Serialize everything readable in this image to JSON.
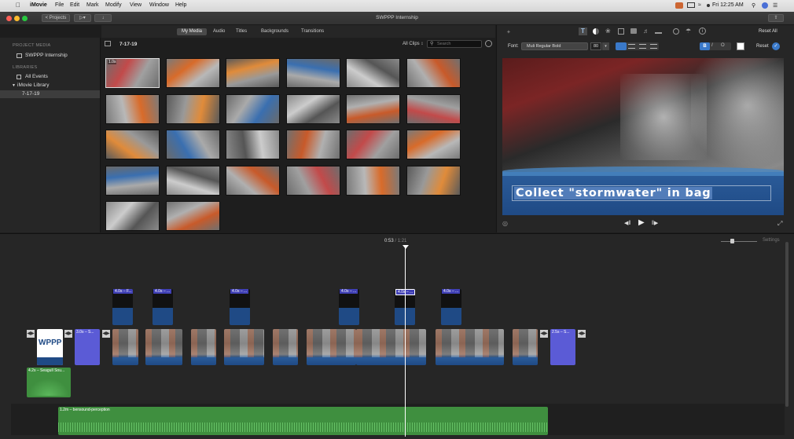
{
  "menubar": {
    "app": "iMovie",
    "items": [
      "File",
      "Edit",
      "Mark",
      "Modify",
      "View",
      "Window",
      "Help"
    ],
    "clock": "Fri 12:25 AM"
  },
  "window": {
    "title": "SWPPP Internship",
    "projects_label": "< Projects"
  },
  "browser_tabs": [
    "My Media",
    "Audio",
    "Titles",
    "Backgrounds",
    "Transitions"
  ],
  "sidebar": {
    "project_media_header": "PROJECT MEDIA",
    "project_name": "SWPPP Internship",
    "libraries_header": "LIBRARIES",
    "all_events": "All Events",
    "library": "iMovie Library",
    "event": "7-17-19"
  },
  "browser": {
    "event_title": "7-17-19",
    "filter": "All Clips ↕",
    "search_placeholder": "Search",
    "first_thumb_duration": "1.0s"
  },
  "viewer": {
    "reset_all": "Reset All",
    "font_label": "Font:",
    "font_value": "Muli Regular Bold",
    "font_size": "80",
    "reset": "Reset",
    "caption": "Collect \"stormwater\" in bag"
  },
  "timeline": {
    "timecode_current": "0:53",
    "timecode_sep": "/",
    "timecode_total": "1:21",
    "settings": "Settings",
    "clip_3s": "3.0s – S...",
    "clip_25s": "2.5s – S...",
    "overlay_1": "4.0s – F...",
    "overlay_n": "4.0s – ...",
    "seagull": "4.2s – Seagull Sou...",
    "music": "1.2m – bensound-perception"
  },
  "colors": {
    "accent": "#4a90e2",
    "title_clip": "#5b5bd6",
    "audio": "#3f8f3f",
    "selection": "#355a88"
  }
}
